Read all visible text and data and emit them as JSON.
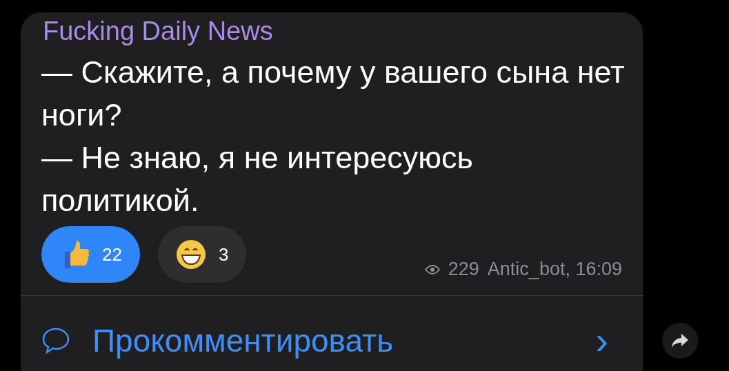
{
  "channel": {
    "name": "Fucking Daily News"
  },
  "message": {
    "paragraphs": [
      "— Скажите, а почему у вашего сына нет ноги?",
      "— Не знаю, я не интересуюсь политикой."
    ]
  },
  "reactions": [
    {
      "kind": "thumbs",
      "count": "22",
      "selected": true
    },
    {
      "kind": "grin",
      "count": "3",
      "selected": false
    }
  ],
  "meta": {
    "views": "229",
    "signature": "Antic_bot, 16:09"
  },
  "comments": {
    "label": "Прокомментировать",
    "arrow": "›"
  }
}
